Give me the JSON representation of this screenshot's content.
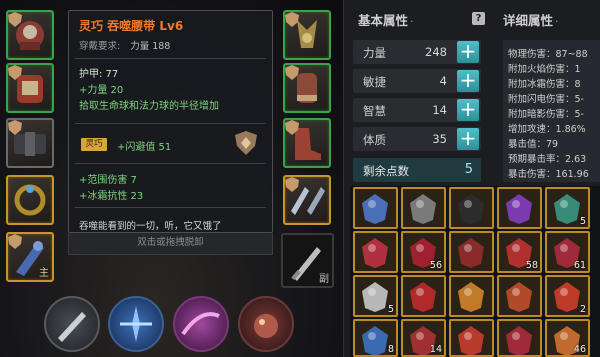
{
  "tooltip": {
    "title": "灵巧 吞噬腰带 Lv6",
    "req_label": "穿戴要求:",
    "req_value": "力量 188",
    "armor": "护甲: 77",
    "strength_bonus": "+力量 20",
    "pickup": "拾取生命球和法力球的半径增加",
    "enchant_tag": "灵巧",
    "enchant_text": "+闪避值 51",
    "range_dmg": "+范围伤害 7",
    "frost_res": "+冰霜抗性 23",
    "flavor": "吞噬能看到的一切，听，它又饿了"
  },
  "hint": "双击或拖拽脱卸",
  "equipment": {
    "left_ring_label": "主",
    "weapon_slot_label": "副"
  },
  "basic": {
    "header": "基本属性",
    "header_suffix": "·",
    "help": "?",
    "stats": [
      {
        "name": "力量",
        "value": "248"
      },
      {
        "name": "敏捷",
        "value": "4"
      },
      {
        "name": "智慧",
        "value": "14"
      },
      {
        "name": "体质",
        "value": "35"
      }
    ],
    "plus": "+",
    "remaining_label": "剩余点数",
    "remaining_value": "5"
  },
  "detail": {
    "header": "详细属性",
    "header_suffix": "·",
    "lines": [
      "物理伤害：87~88",
      "附加火焰伤害：1",
      "附加冰霜伤害：8",
      "附加闪电伤害：5-",
      "附加暗影伤害：5-",
      "增加攻速：1.86%",
      "暴击值：79",
      "预期暴击率：2.63",
      "暴击伤害：161.96"
    ]
  },
  "inventory": {
    "counts": [
      "",
      "",
      "",
      "",
      "5",
      "",
      "56",
      "",
      "58",
      "61",
      "5",
      "",
      "",
      "",
      "2",
      "8",
      "14",
      "",
      "",
      "46",
      "",
      "",
      "",
      ""
    ]
  },
  "colors": {
    "accent": "#3fb8c2",
    "title_orange": "#ee7a2e",
    "bonus_green": "#7ed47e",
    "slot_gold": "#c9952b",
    "slot_green": "#39a347"
  }
}
